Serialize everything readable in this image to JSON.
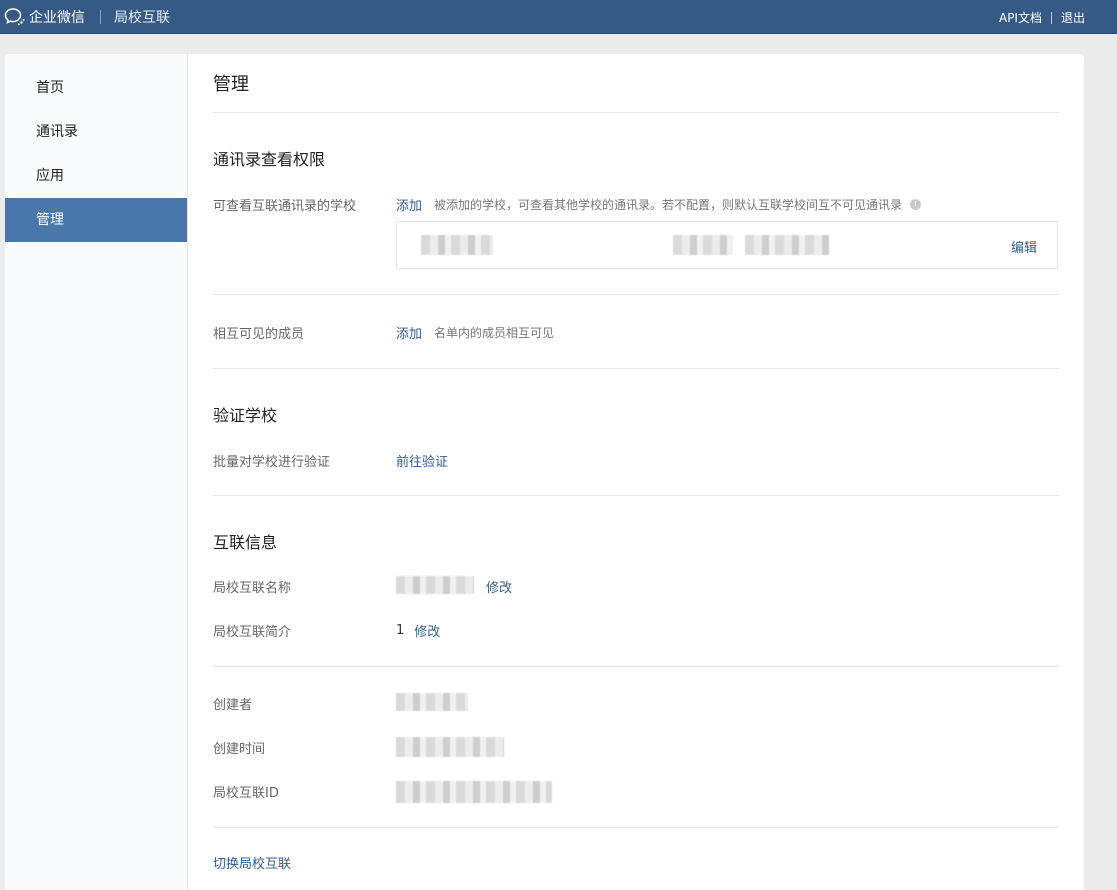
{
  "topbar": {
    "brand": "企业微信",
    "product": "局校互联",
    "links": {
      "api_docs": "API文档",
      "logout": "退出"
    }
  },
  "sidebar": {
    "items": [
      {
        "label": "首页",
        "active": false
      },
      {
        "label": "通讯录",
        "active": false
      },
      {
        "label": "应用",
        "active": false
      },
      {
        "label": "管理",
        "active": true
      }
    ]
  },
  "main": {
    "title": "管理",
    "contact_permission": {
      "title": "通讯录查看权限",
      "schools_label": "可查看互联通讯录的学校",
      "schools_add": "添加",
      "schools_hint": "被添加的学校，可查看其他学校的通讯录。若不配置，则默认互联学校间互不可见通讯录",
      "schools_edit": "编辑",
      "members_label": "相互可见的成员",
      "members_add": "添加",
      "members_hint": "名单内的成员相互可见"
    },
    "verify": {
      "title": "验证学校",
      "batch_label": "批量对学校进行验证",
      "batch_link": "前往验证"
    },
    "info": {
      "title": "互联信息",
      "name_label": "局校互联名称",
      "name_edit": "修改",
      "intro_label": "局校互联简介",
      "intro_value": "1",
      "intro_edit": "修改",
      "creator_label": "创建者",
      "created_time_label": "创建时间",
      "id_label": "局校互联ID"
    },
    "switch_link": "切换局校互联"
  },
  "colors": {
    "topbar": "#365a86",
    "sidebar_active": "#4a78ad",
    "link": "#2d5e94"
  }
}
